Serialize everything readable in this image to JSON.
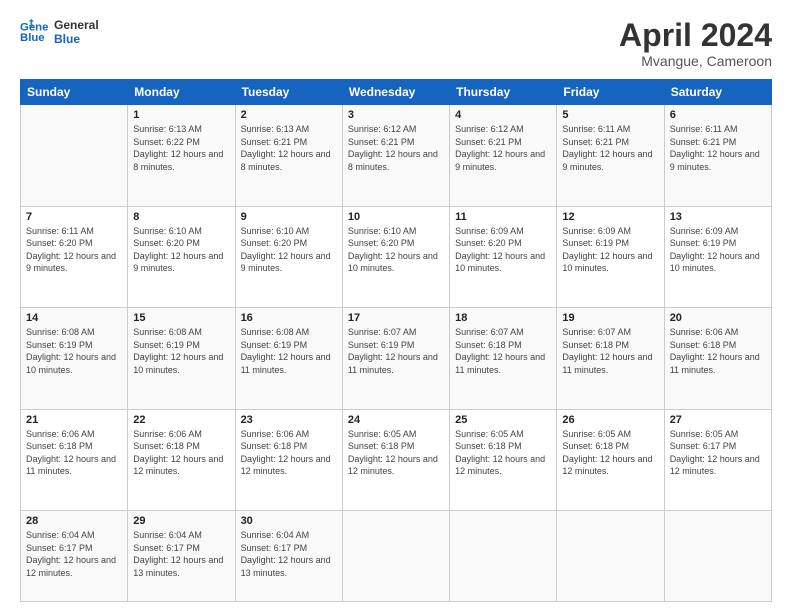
{
  "header": {
    "logo_line1": "General",
    "logo_line2": "Blue",
    "month": "April 2024",
    "location": "Mvangue, Cameroon"
  },
  "days_of_week": [
    "Sunday",
    "Monday",
    "Tuesday",
    "Wednesday",
    "Thursday",
    "Friday",
    "Saturday"
  ],
  "weeks": [
    [
      {
        "day": "",
        "sunrise": "",
        "sunset": "",
        "daylight": ""
      },
      {
        "day": "1",
        "sunrise": "6:13 AM",
        "sunset": "6:22 PM",
        "daylight": "12 hours and 8 minutes."
      },
      {
        "day": "2",
        "sunrise": "6:13 AM",
        "sunset": "6:21 PM",
        "daylight": "12 hours and 8 minutes."
      },
      {
        "day": "3",
        "sunrise": "6:12 AM",
        "sunset": "6:21 PM",
        "daylight": "12 hours and 8 minutes."
      },
      {
        "day": "4",
        "sunrise": "6:12 AM",
        "sunset": "6:21 PM",
        "daylight": "12 hours and 9 minutes."
      },
      {
        "day": "5",
        "sunrise": "6:11 AM",
        "sunset": "6:21 PM",
        "daylight": "12 hours and 9 minutes."
      },
      {
        "day": "6",
        "sunrise": "6:11 AM",
        "sunset": "6:21 PM",
        "daylight": "12 hours and 9 minutes."
      }
    ],
    [
      {
        "day": "7",
        "sunrise": "6:11 AM",
        "sunset": "6:20 PM",
        "daylight": "12 hours and 9 minutes."
      },
      {
        "day": "8",
        "sunrise": "6:10 AM",
        "sunset": "6:20 PM",
        "daylight": "12 hours and 9 minutes."
      },
      {
        "day": "9",
        "sunrise": "6:10 AM",
        "sunset": "6:20 PM",
        "daylight": "12 hours and 9 minutes."
      },
      {
        "day": "10",
        "sunrise": "6:10 AM",
        "sunset": "6:20 PM",
        "daylight": "12 hours and 10 minutes."
      },
      {
        "day": "11",
        "sunrise": "6:09 AM",
        "sunset": "6:20 PM",
        "daylight": "12 hours and 10 minutes."
      },
      {
        "day": "12",
        "sunrise": "6:09 AM",
        "sunset": "6:19 PM",
        "daylight": "12 hours and 10 minutes."
      },
      {
        "day": "13",
        "sunrise": "6:09 AM",
        "sunset": "6:19 PM",
        "daylight": "12 hours and 10 minutes."
      }
    ],
    [
      {
        "day": "14",
        "sunrise": "6:08 AM",
        "sunset": "6:19 PM",
        "daylight": "12 hours and 10 minutes."
      },
      {
        "day": "15",
        "sunrise": "6:08 AM",
        "sunset": "6:19 PM",
        "daylight": "12 hours and 10 minutes."
      },
      {
        "day": "16",
        "sunrise": "6:08 AM",
        "sunset": "6:19 PM",
        "daylight": "12 hours and 11 minutes."
      },
      {
        "day": "17",
        "sunrise": "6:07 AM",
        "sunset": "6:19 PM",
        "daylight": "12 hours and 11 minutes."
      },
      {
        "day": "18",
        "sunrise": "6:07 AM",
        "sunset": "6:18 PM",
        "daylight": "12 hours and 11 minutes."
      },
      {
        "day": "19",
        "sunrise": "6:07 AM",
        "sunset": "6:18 PM",
        "daylight": "12 hours and 11 minutes."
      },
      {
        "day": "20",
        "sunrise": "6:06 AM",
        "sunset": "6:18 PM",
        "daylight": "12 hours and 11 minutes."
      }
    ],
    [
      {
        "day": "21",
        "sunrise": "6:06 AM",
        "sunset": "6:18 PM",
        "daylight": "12 hours and 11 minutes."
      },
      {
        "day": "22",
        "sunrise": "6:06 AM",
        "sunset": "6:18 PM",
        "daylight": "12 hours and 12 minutes."
      },
      {
        "day": "23",
        "sunrise": "6:06 AM",
        "sunset": "6:18 PM",
        "daylight": "12 hours and 12 minutes."
      },
      {
        "day": "24",
        "sunrise": "6:05 AM",
        "sunset": "6:18 PM",
        "daylight": "12 hours and 12 minutes."
      },
      {
        "day": "25",
        "sunrise": "6:05 AM",
        "sunset": "6:18 PM",
        "daylight": "12 hours and 12 minutes."
      },
      {
        "day": "26",
        "sunrise": "6:05 AM",
        "sunset": "6:18 PM",
        "daylight": "12 hours and 12 minutes."
      },
      {
        "day": "27",
        "sunrise": "6:05 AM",
        "sunset": "6:17 PM",
        "daylight": "12 hours and 12 minutes."
      }
    ],
    [
      {
        "day": "28",
        "sunrise": "6:04 AM",
        "sunset": "6:17 PM",
        "daylight": "12 hours and 12 minutes."
      },
      {
        "day": "29",
        "sunrise": "6:04 AM",
        "sunset": "6:17 PM",
        "daylight": "12 hours and 13 minutes."
      },
      {
        "day": "30",
        "sunrise": "6:04 AM",
        "sunset": "6:17 PM",
        "daylight": "12 hours and 13 minutes."
      },
      {
        "day": "",
        "sunrise": "",
        "sunset": "",
        "daylight": ""
      },
      {
        "day": "",
        "sunrise": "",
        "sunset": "",
        "daylight": ""
      },
      {
        "day": "",
        "sunrise": "",
        "sunset": "",
        "daylight": ""
      },
      {
        "day": "",
        "sunrise": "",
        "sunset": "",
        "daylight": ""
      }
    ]
  ]
}
